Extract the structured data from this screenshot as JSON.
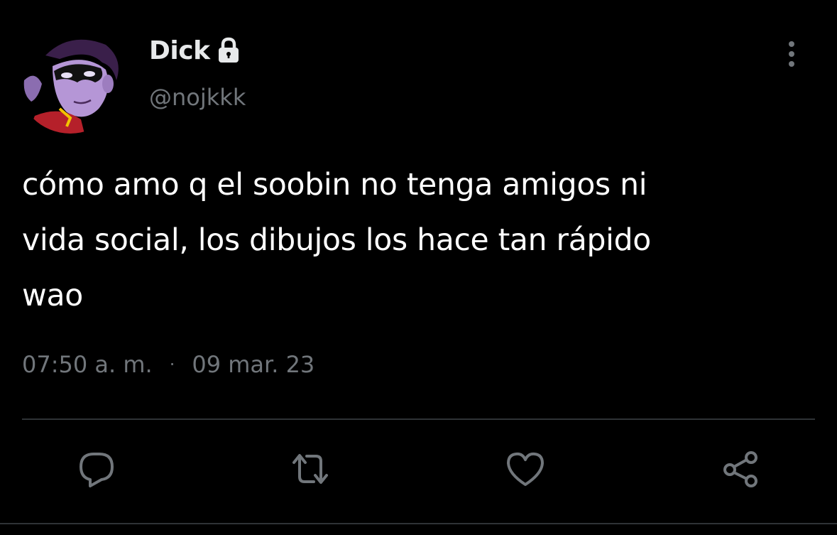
{
  "author": {
    "display_name": "Dick",
    "handle": "@nojkkk",
    "protected_icon": "lock-icon",
    "avatar_icon": "masked-character-avatar"
  },
  "tweet": {
    "text": "cómo amo q el soobin no tenga amigos ni\nvida social, los dibujos los hace tan rápido\nwao",
    "time": "07:50 a. m.",
    "separator": "·",
    "date": "09 mar. 23"
  },
  "menu": {
    "icon": "more-vertical-icon"
  },
  "actions": [
    {
      "name": "reply",
      "icon": "reply-icon"
    },
    {
      "name": "retweet",
      "icon": "retweet-icon"
    },
    {
      "name": "like",
      "icon": "heart-icon"
    },
    {
      "name": "share",
      "icon": "share-icon"
    }
  ],
  "colors": {
    "background": "#000000",
    "text_primary": "#e7e9ea",
    "text_secondary": "#71767b",
    "divider": "#2f3336"
  }
}
